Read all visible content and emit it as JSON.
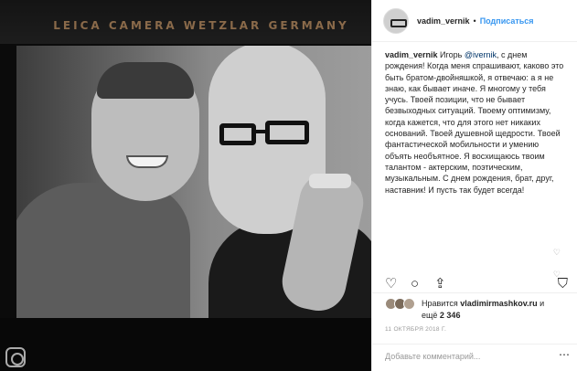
{
  "photo": {
    "camera_text": "LEICA CAMERA WETZLAR GERMANY"
  },
  "header": {
    "username": "vadim_vernik",
    "separator": "•",
    "follow_label": "Подписаться"
  },
  "caption": {
    "username": "vadim_vernik",
    "lead": " Игорь ",
    "mention": "@ivernik",
    "body": ", с днем рождения! Когда меня спрашивают, каково это быть братом-двойняшкой, я отвечаю: а я не знаю, как бывает иначе. Я многому у тебя учусь. Твоей позиции, что не бывает безвыходных ситуаций. Твоему оптимизму, когда кажется, что для этого нет никаких оснований. Твоей душевной щедрости. Твоей фантастической мобильности и умению объять необъятное. Я восхищаюсь твоим талантом - актерским, поэтическим, музыкальным. С днем рождения, брат, друг, наставник! И пусть так будет всегда!"
  },
  "comment_hearts": [
    "♡",
    "♡"
  ],
  "actions": {
    "like_icon": "♡",
    "comment_icon": "○",
    "share_icon": "⇪",
    "save_icon": "⛉"
  },
  "likes": {
    "prefix": "Нравится ",
    "user": "vladimirmashkov.ru",
    "middle": " и",
    "more_prefix": "ещё ",
    "count": "2 346"
  },
  "date": "11 ОКТЯБРЯ 2018 Г.",
  "comment": {
    "placeholder": "Добавьте комментарий...",
    "more_icon": "⋯"
  }
}
